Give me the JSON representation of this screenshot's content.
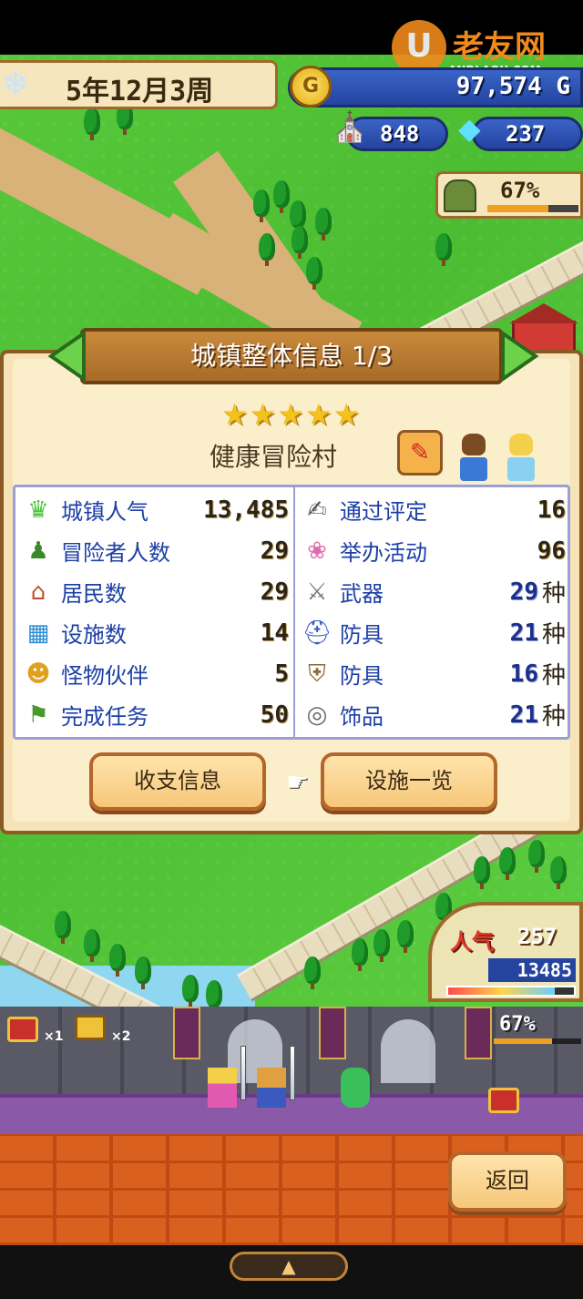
{
  "watermark": {
    "logo_letter": "U",
    "brand": "老友网",
    "domain": "ANDLAOU.COM"
  },
  "hud": {
    "date": "5年12月3周",
    "gold": "97,574 G",
    "adventurer_count": "848",
    "gems": "237",
    "progress_pct": "67%",
    "progress_value": 0.67
  },
  "panel": {
    "title": "城镇整体信息 1/3",
    "stars": "★★★★★",
    "rating": 5,
    "town_name": "健康冒险村",
    "stats_left": [
      {
        "icon": "town-popularity-icon",
        "label": "城镇人气",
        "value": "13,485"
      },
      {
        "icon": "adventurer-icon",
        "label": "冒险者人数",
        "value": "29"
      },
      {
        "icon": "house-icon",
        "label": "居民数",
        "value": "29"
      },
      {
        "icon": "facility-icon",
        "label": "设施数",
        "value": "14"
      },
      {
        "icon": "monster-icon",
        "label": "怪物伙伴",
        "value": "5"
      },
      {
        "icon": "quest-icon",
        "label": "完成任务",
        "value": "50"
      }
    ],
    "stats_right": [
      {
        "icon": "evaluation-icon",
        "label": "通过评定",
        "value": "16",
        "unit": ""
      },
      {
        "icon": "balloon-icon",
        "label": "举办活动",
        "value": "96",
        "unit": ""
      },
      {
        "icon": "sword-icon",
        "label": "武器",
        "value": "29",
        "unit": "种"
      },
      {
        "icon": "helmet-icon",
        "label": "防具",
        "value": "21",
        "unit": "种"
      },
      {
        "icon": "armor-icon",
        "label": "防具",
        "value": "16",
        "unit": "种"
      },
      {
        "icon": "ring-icon",
        "label": "饰品",
        "value": "21",
        "unit": "种"
      }
    ],
    "buttons": {
      "finance": "收支信息",
      "facilities": "设施一览"
    }
  },
  "popularity": {
    "label": "人气",
    "rank": "257",
    "value": "13485",
    "bar_level": 0.85
  },
  "dungeon": {
    "red_chest_count": "×1",
    "gold_chest_count": "×2",
    "progress_pct": "67%",
    "progress_value": 0.67
  },
  "footer": {
    "back": "返回",
    "handle": "▲"
  },
  "colors": {
    "accent": "#1d3fa6",
    "panel": "#f6e3b7",
    "button": "#f6c779"
  }
}
